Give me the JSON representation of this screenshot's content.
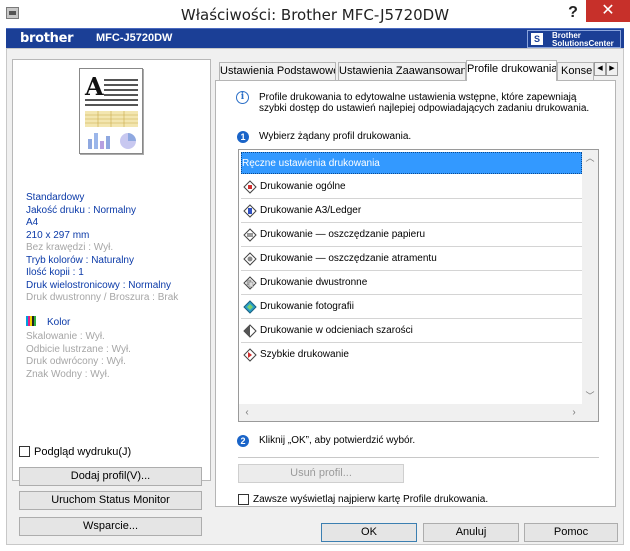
{
  "window": {
    "title": "Właściwości: Brother MFC-J5720DW",
    "help_label": "?",
    "close_label": "✕"
  },
  "brandbar": {
    "logo_text": "brother",
    "model": "MFC-J5720DW",
    "solutions_line1": "Brother",
    "solutions_line2": "SolutionsCenter"
  },
  "left_panel": {
    "settings": [
      {
        "text": "Standardowy",
        "enabled": true
      },
      {
        "text": "Jakość druku : Normalny",
        "enabled": true
      },
      {
        "text": "A4",
        "enabled": true
      },
      {
        "text": "210 x 297 mm",
        "enabled": true
      },
      {
        "text": "Bez krawędzi : Wył.",
        "enabled": false
      },
      {
        "text": "Tryb kolorów : Naturalny",
        "enabled": true
      },
      {
        "text": "Ilość kopii  : 1",
        "enabled": true
      },
      {
        "text": "Druk wielostronicowy  : Normalny",
        "enabled": true
      },
      {
        "text": "Druk dwustronny / Broszura : Brak",
        "enabled": false
      }
    ],
    "color_label": "Kolor",
    "extra_settings": [
      "Skalowanie : Wył.",
      "Odbicie lustrzane  : Wył.",
      "Druk odwrócony  : Wył.",
      "Znak Wodny : Wył."
    ],
    "print_preview_label": "Podgląd wydruku(J)",
    "print_preview_checked": false,
    "add_profile_button": "Dodaj profil(V)...",
    "status_monitor_button": "Uruchom Status Monitor",
    "support_button": "Wsparcie..."
  },
  "tabs": [
    {
      "label": "Ustawienia Podstawowe",
      "active": false
    },
    {
      "label": "Ustawienia Zaawansowane",
      "active": false
    },
    {
      "label": "Profile drukowania",
      "active": true
    },
    {
      "label": "Konser",
      "active": false
    }
  ],
  "icons": {
    "tab_prev": "◀",
    "tab_next": "▶",
    "scroll_up": "︿",
    "scroll_down": "﹀",
    "scroll_left": "‹",
    "scroll_right": "›",
    "info": "i"
  },
  "profiles_tab": {
    "description": "Profile drukowania to edytowalne ustawienia wstępne, które zapewniają szybki dostęp do ustawień najlepiej odpowiadających zadaniu drukowania.",
    "step1_number": "1",
    "step1_text": "Wybierz żądany profil drukowania.",
    "profiles": [
      {
        "label": "Ręczne ustawienia drukowania",
        "icon": "none",
        "selected": true
      },
      {
        "label": "Drukowanie ogólne",
        "icon": "general-print-icon",
        "selected": false
      },
      {
        "label": "Drukowanie A3/Ledger",
        "icon": "a3-print-icon",
        "selected": false
      },
      {
        "label": "Drukowanie — oszczędzanie papieru",
        "icon": "paper-save-icon",
        "selected": false
      },
      {
        "label": "Drukowanie — oszczędzanie atramentu",
        "icon": "ink-save-icon",
        "selected": false
      },
      {
        "label": "Drukowanie dwustronne",
        "icon": "duplex-icon",
        "selected": false
      },
      {
        "label": "Drukowanie fotografii",
        "icon": "photo-print-icon",
        "selected": false
      },
      {
        "label": "Drukowanie w odcieniach szarości",
        "icon": "grayscale-icon",
        "selected": false
      },
      {
        "label": "Szybkie drukowanie",
        "icon": "fast-print-icon",
        "selected": false
      }
    ],
    "step2_number": "2",
    "step2_text": "Kliknij „OK”, aby potwierdzić wybór.",
    "remove_profile_button": "Usuń profil...",
    "always_show_label": "Zawsze wyświetlaj najpierw kartę Profile drukowania.",
    "always_show_checked": false
  },
  "footer": {
    "ok": "OK",
    "cancel": "Anuluj",
    "help": "Pomoc"
  },
  "colors": {
    "brand_blue": "#1b3f96",
    "selection_blue": "#3399ff",
    "info_text_blue": "#0b3aa8",
    "close_red": "#c7302a"
  }
}
